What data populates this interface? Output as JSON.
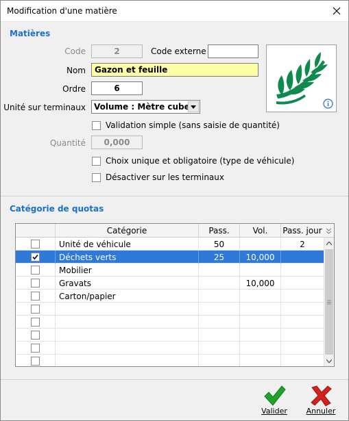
{
  "window": {
    "title": "Modification d'une matière"
  },
  "matieres": {
    "section_title": "Matières",
    "code_label": "Code",
    "code_value": "2",
    "code_externe_label": "Code externe",
    "code_externe_value": "",
    "nom_label": "Nom",
    "nom_value": "Gazon et feuille",
    "ordre_label": "Ordre",
    "ordre_value": "6",
    "unite_label": "Unité sur terminaux",
    "unite_value": "Volume : Mètre cube",
    "validation_label": "Validation simple (sans saisie de quantité)",
    "validation_checked": false,
    "quantite_label": "Quantité",
    "quantite_value": "0,000",
    "choix_label": "Choix unique et obligatoire (type de véhicule)",
    "choix_checked": false,
    "desactiver_label": "Désactiver sur les terminaux",
    "desactiver_checked": false,
    "logo_icon": "leaf-branch-icon",
    "info_icon": "info-icon",
    "accent_color": "#1a6fd1",
    "logo_color": "#0e8a4f"
  },
  "quotas": {
    "section_title": "Catégorie de quotas",
    "columns": [
      "Catégorie",
      "Pass.",
      "Vol.",
      "Pass. jour"
    ],
    "rows": [
      {
        "checked": false,
        "categorie": "Unité de véhicule",
        "pass": "50",
        "vol": "",
        "pass_jour": "2",
        "selected": false
      },
      {
        "checked": true,
        "categorie": "Déchets verts",
        "pass": "25",
        "vol": "10,000",
        "pass_jour": "",
        "selected": true
      },
      {
        "checked": false,
        "categorie": "Mobilier",
        "pass": "",
        "vol": "",
        "pass_jour": "",
        "selected": false
      },
      {
        "checked": false,
        "categorie": "Gravats",
        "pass": "",
        "vol": "10,000",
        "pass_jour": "",
        "selected": false
      },
      {
        "checked": false,
        "categorie": "Carton/papier",
        "pass": "",
        "vol": "",
        "pass_jour": "",
        "selected": false
      },
      {
        "checked": false,
        "categorie": "",
        "pass": "",
        "vol": "",
        "pass_jour": "",
        "selected": false
      },
      {
        "checked": false,
        "categorie": "",
        "pass": "",
        "vol": "",
        "pass_jour": "",
        "selected": false
      },
      {
        "checked": false,
        "categorie": "",
        "pass": "",
        "vol": "",
        "pass_jour": "",
        "selected": false
      },
      {
        "checked": false,
        "categorie": "",
        "pass": "",
        "vol": "",
        "pass_jour": "",
        "selected": false
      },
      {
        "checked": false,
        "categorie": "",
        "pass": "",
        "vol": "",
        "pass_jour": "",
        "selected": false
      }
    ],
    "selection_color": "#2f7ad6"
  },
  "actions": {
    "valider_label": "Valider",
    "annuler_label": "Annuler",
    "valider_color": "#1fa22a",
    "annuler_color": "#d42020"
  }
}
